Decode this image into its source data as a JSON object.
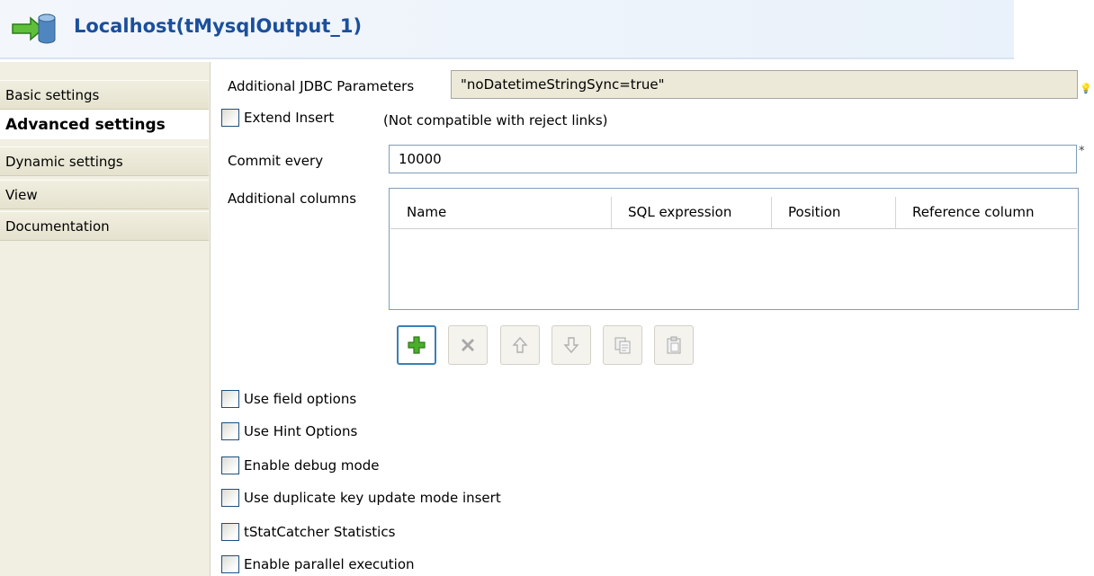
{
  "header": {
    "title": "Localhost(tMysqlOutput_1)"
  },
  "tabs": [
    {
      "label": "Basic settings"
    },
    {
      "label": "Advanced settings"
    },
    {
      "label": "Dynamic settings"
    },
    {
      "label": "View"
    },
    {
      "label": "Documentation"
    }
  ],
  "jdbc": {
    "label": "Additional JDBC Parameters",
    "value": "\"noDatetimeStringSync=true\"",
    "hint_marker": "💡"
  },
  "extend_insert": {
    "label": "Extend Insert",
    "note": "(Not compatible with reject links)"
  },
  "commit": {
    "label": "Commit every",
    "value": "10000",
    "marker": "*"
  },
  "additional_columns": {
    "label": "Additional columns",
    "headers": [
      "Name",
      "SQL expression",
      "Position",
      "Reference column"
    ],
    "rows": []
  },
  "toolbar": {
    "buttons": [
      {
        "name": "add-icon",
        "enabled": true
      },
      {
        "name": "delete-icon",
        "enabled": false
      },
      {
        "name": "move-up-icon",
        "enabled": false
      },
      {
        "name": "move-down-icon",
        "enabled": false
      },
      {
        "name": "copy-icon",
        "enabled": false
      },
      {
        "name": "paste-icon",
        "enabled": false
      }
    ]
  },
  "checkboxes": [
    {
      "label": "Use field options",
      "checked": false
    },
    {
      "label": "Use Hint Options",
      "checked": false
    },
    {
      "label": "Enable debug mode",
      "checked": false
    },
    {
      "label": "Use duplicate key update mode insert",
      "checked": false
    },
    {
      "label": "tStatCatcher Statistics",
      "checked": false
    },
    {
      "label": "Enable parallel execution",
      "checked": false
    }
  ],
  "colors": {
    "title": "#1a4f9c",
    "accent_border": "#3c7fb1",
    "add_green": "#3aa02a"
  }
}
